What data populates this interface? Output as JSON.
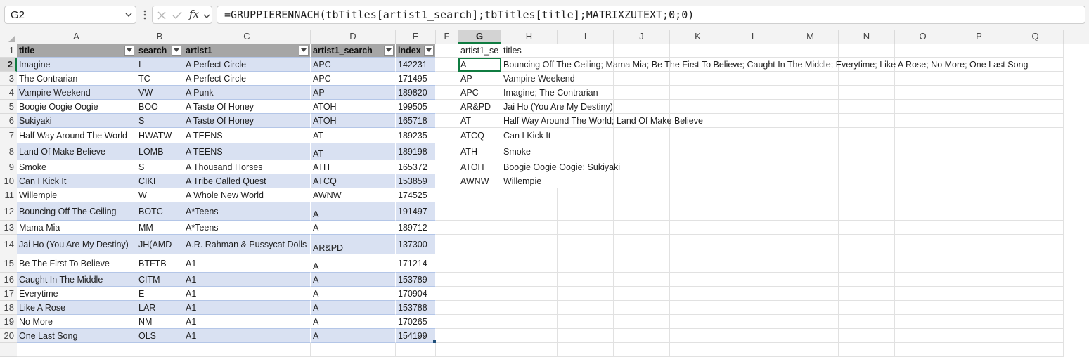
{
  "namebox": {
    "value": "G2",
    "chevron_icon": "chevron-down-icon"
  },
  "formula_controls": {
    "cancel_icon": "cancel-x-icon",
    "enter_icon": "enter-check-icon",
    "fx_label": "fx",
    "expand_icon": "chevron-down-icon"
  },
  "formula": "=GRUPPIERENNACH(tbTitles[artist1_search];tbTitles[title];MATRIXZUTEXT;0;0)",
  "selected_cell": "G2",
  "colors": {
    "table_header": "#a6a6a6",
    "table_band": "#d9e1f2",
    "selection": "#107c41"
  },
  "columns": [
    "A",
    "B",
    "C",
    "D",
    "E",
    "F",
    "G",
    "H",
    "I",
    "J",
    "K",
    "L",
    "M",
    "N",
    "O",
    "P",
    "Q"
  ],
  "table": {
    "name": "tbTitles",
    "headers": [
      "title",
      "search",
      "artist1",
      "artist1_search",
      "index"
    ],
    "rows": [
      [
        "Imagine",
        "I",
        "A Perfect Circle",
        "APC",
        "142231"
      ],
      [
        "The Contrarian",
        "TC",
        "A Perfect Circle",
        "APC",
        "171495"
      ],
      [
        "Vampire Weekend",
        "VW",
        "A Punk",
        "AP",
        "189820"
      ],
      [
        "Boogie Oogie Oogie",
        "BOO",
        "A Taste Of Honey",
        "ATOH",
        "199505"
      ],
      [
        "Sukiyaki",
        "S",
        "A Taste Of Honey",
        "ATOH",
        "165718"
      ],
      [
        "Half Way Around The World",
        "HWATW",
        "A TEENS",
        "AT",
        "189235"
      ],
      [
        "Land Of Make Believe",
        "LOMB",
        "A TEENS",
        "AT",
        "189198"
      ],
      [
        "Smoke",
        "S",
        "A Thousand Horses",
        "ATH",
        "165372"
      ],
      [
        "Can I Kick It",
        "CIKI",
        "A Tribe Called Quest",
        "ATCQ",
        "153859"
      ],
      [
        "Willempie",
        "W",
        "A Whole New World",
        "AWNW",
        "174525"
      ],
      [
        "Bouncing Off The Ceiling",
        "BOTC",
        "A*Teens",
        "A",
        "191497"
      ],
      [
        "Mama Mia",
        "MM",
        "A*Teens",
        "A",
        "189712"
      ],
      [
        "Jai Ho (You Are My Destiny)",
        "JH(AMD",
        "A.R. Rahman & Pussycat Dolls",
        "AR&PD",
        "137300"
      ],
      [
        "Be The First To Believe",
        "BTFTB",
        "A1",
        "A",
        "171214"
      ],
      [
        "Caught In The Middle",
        "CITM",
        "A1",
        "A",
        "153789"
      ],
      [
        "Everytime",
        "E",
        "A1",
        "A",
        "170904"
      ],
      [
        "Like A Rose",
        "LAR",
        "A1",
        "A",
        "153788"
      ],
      [
        "No More",
        "NM",
        "A1",
        "A",
        "170265"
      ],
      [
        "One Last Song",
        "OLS",
        "A1",
        "A",
        "154199"
      ]
    ]
  },
  "result": {
    "headers": [
      "artist1_se",
      "titles"
    ],
    "rows": [
      [
        "A",
        "Bouncing Off The Ceiling; Mama Mia; Be The First To Believe; Caught In The Middle; Everytime; Like A Rose; No More; One Last Song"
      ],
      [
        "AP",
        "Vampire Weekend"
      ],
      [
        "APC",
        "Imagine; The Contrarian"
      ],
      [
        "AR&PD",
        "Jai Ho (You Are My Destiny)"
      ],
      [
        "AT",
        "Half Way Around The World; Land Of Make Believe"
      ],
      [
        "ATCQ",
        "Can I Kick It"
      ],
      [
        "ATH",
        "Smoke"
      ],
      [
        "ATOH",
        "Boogie Oogie Oogie; Sukiyaki"
      ],
      [
        "AWNW",
        "Willempie"
      ]
    ]
  },
  "filter_icon": "filter-dropdown-icon"
}
